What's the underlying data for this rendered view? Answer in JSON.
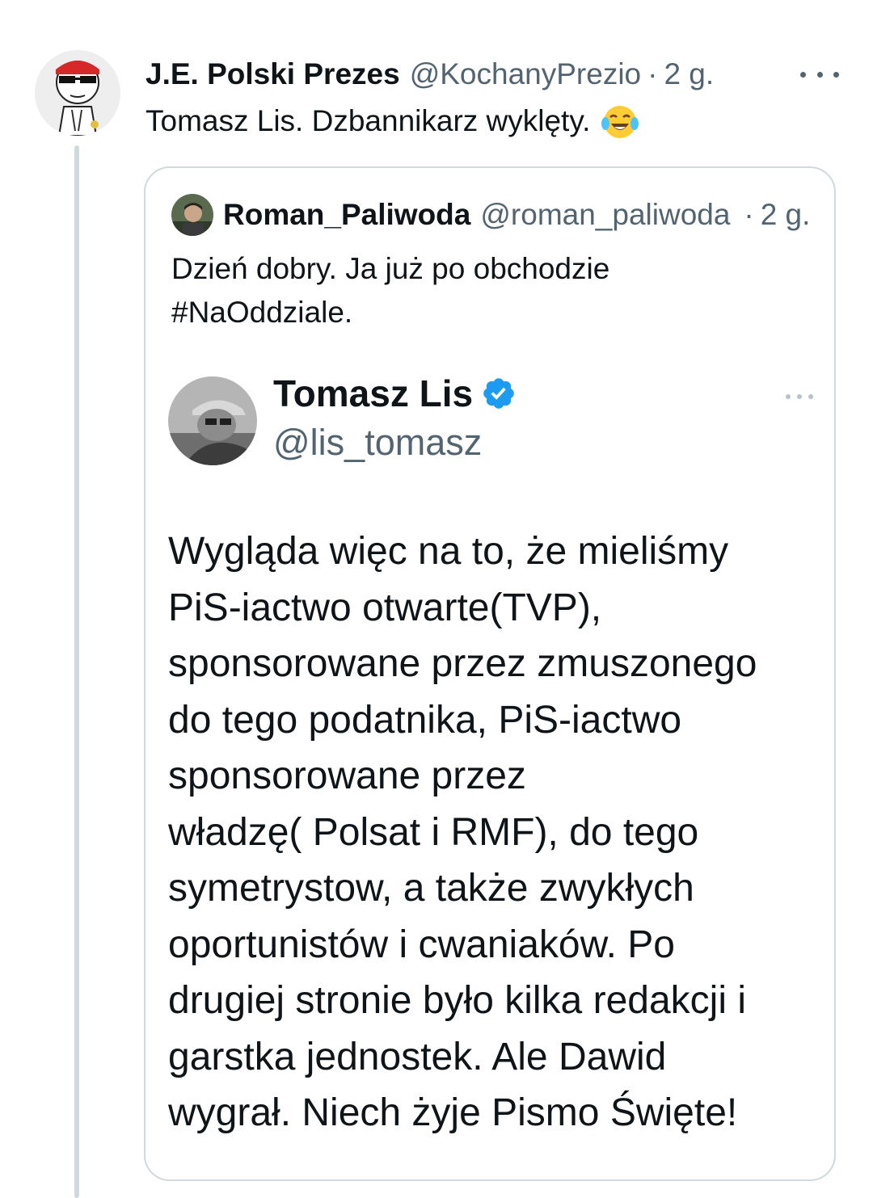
{
  "tweet": {
    "author_name": "J.E. Polski Prezes",
    "author_handle": "@KochanyPrezio",
    "separator": "·",
    "time": "2 g.",
    "more_icon": "more-horizontal-icon",
    "text": "Tomasz Lis. Dzbannikarz wyklęty.",
    "emoji": "face-with-tears-of-joy"
  },
  "quoted_tweet": {
    "author_name": "Roman_Paliwoda",
    "author_handle": "@roman_paliwoda",
    "separator": "·",
    "time": "2 g.",
    "text_lines": [
      "Dzień dobry. Ja już po obchodzie",
      "#NaOddziale."
    ],
    "screenshot": {
      "name": "Tomasz Lis",
      "handle": "@lis_tomasz",
      "verified": true,
      "verified_color": "#1d9bf0",
      "body_lines": [
        "Wygląda więc na to, że mieliśmy",
        "PiS-iactwo otwarte(TVP),",
        "sponsorowane przez zmuszonego",
        "do tego podatnika, PiS-iactwo",
        "sponsorowane przez",
        "władzę( Polsat i RMF), do tego",
        "symetrystow, a także zwykłych",
        "oportunistów i cwaniaków. Po",
        "drugiej stronie było kilka redakcji i",
        "garstka jednostek. Ale Dawid",
        "wygrał. Niech żyje Pismo Święte!"
      ]
    }
  },
  "colors": {
    "text": "#0f1419",
    "secondary": "#536471",
    "border": "#cfd9de",
    "accent": "#1d9bf0"
  }
}
